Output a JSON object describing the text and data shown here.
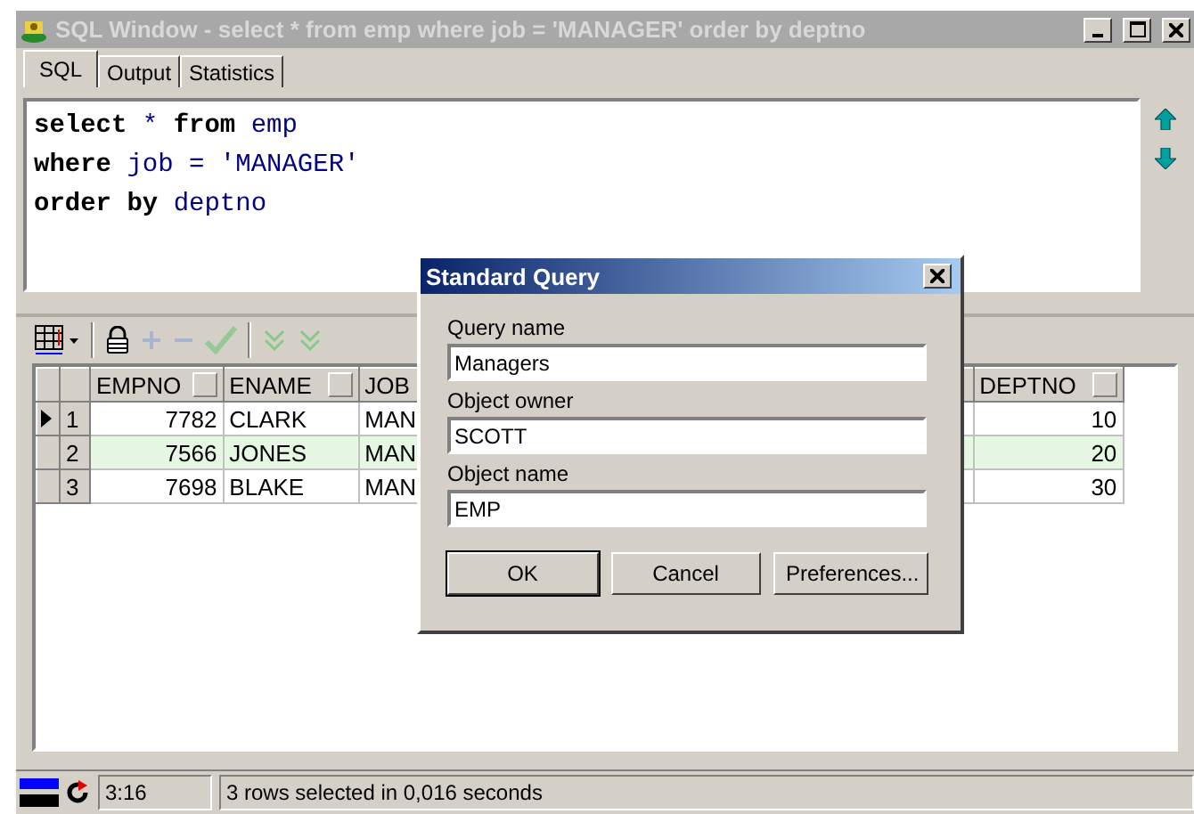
{
  "window": {
    "title": "SQL Window - select * from emp where job = 'MANAGER' order by deptno"
  },
  "tabs": [
    {
      "label": "SQL",
      "selected": true
    },
    {
      "label": "Output",
      "selected": false
    },
    {
      "label": "Statistics",
      "selected": false
    }
  ],
  "editor": {
    "lines": [
      "**select** * **from** emp",
      "**where** job = 'MANAGER'",
      "**order by** deptno"
    ]
  },
  "grid": {
    "columns": [
      "EMPNO",
      "ENAME",
      "JOB",
      "DEPTNO"
    ],
    "rows": [
      {
        "number": "1",
        "current": true,
        "highlighted": false,
        "cells": [
          "7782",
          "CLARK",
          "MAN",
          "10"
        ]
      },
      {
        "number": "2",
        "current": false,
        "highlighted": true,
        "cells": [
          "7566",
          "JONES",
          "MAN",
          "20"
        ]
      },
      {
        "number": "3",
        "current": false,
        "highlighted": false,
        "cells": [
          "7698",
          "BLAKE",
          "MAN",
          "30"
        ]
      }
    ]
  },
  "dialog": {
    "title": "Standard Query",
    "fields": [
      {
        "label": "Query name",
        "value": "Managers"
      },
      {
        "label": "Object owner",
        "value": "SCOTT"
      },
      {
        "label": "Object name",
        "value": "EMP"
      }
    ],
    "buttons": [
      {
        "label": "OK",
        "default": true
      },
      {
        "label": "Cancel",
        "default": false
      },
      {
        "label": "Preferences...",
        "default": false
      }
    ]
  },
  "status_bar": {
    "time": "3:16",
    "message": "3 rows selected in 0,016 seconds"
  }
}
